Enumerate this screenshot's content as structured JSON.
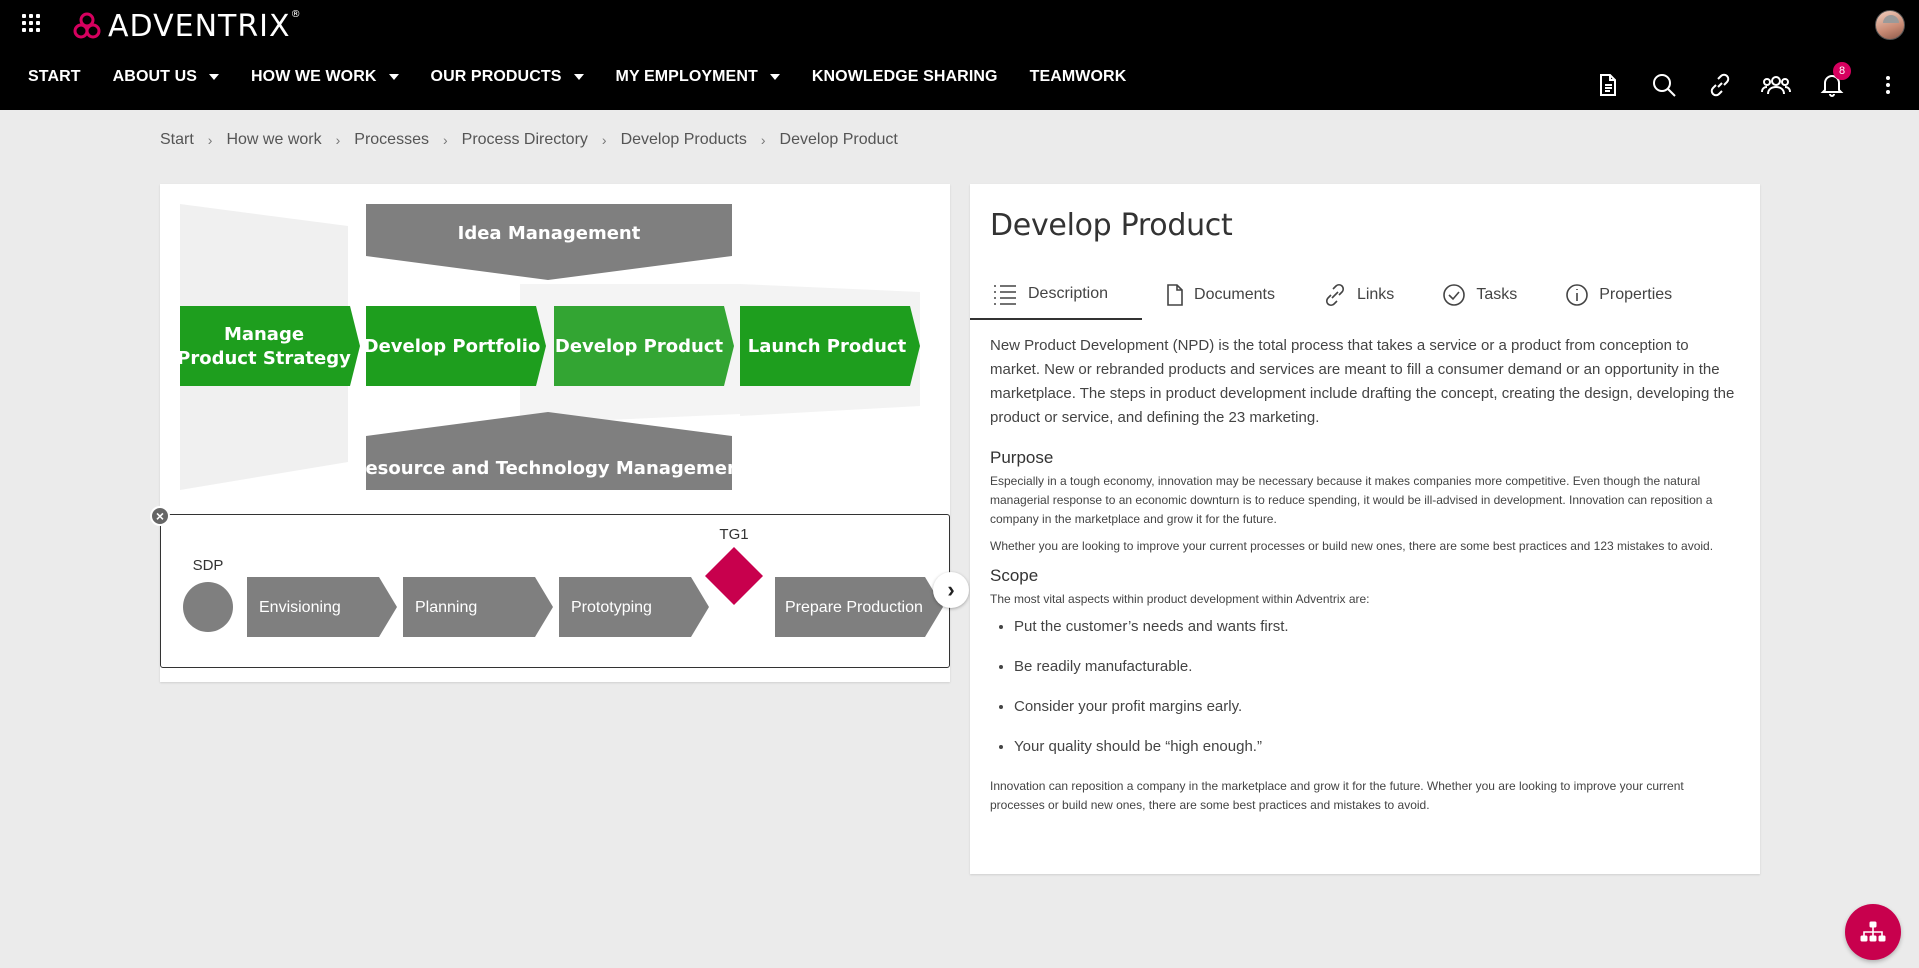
{
  "brand": {
    "name": "ADVENTRIX",
    "registered": "®",
    "accent": "#d6005f"
  },
  "nav": [
    {
      "label": "START",
      "dropdown": false
    },
    {
      "label": "ABOUT US",
      "dropdown": true
    },
    {
      "label": "HOW WE WORK",
      "dropdown": true
    },
    {
      "label": "OUR PRODUCTS",
      "dropdown": true
    },
    {
      "label": "MY EMPLOYMENT",
      "dropdown": true
    },
    {
      "label": "KNOWLEDGE SHARING",
      "dropdown": false
    },
    {
      "label": "TEAMWORK",
      "dropdown": false
    }
  ],
  "toolbar": {
    "icons": [
      "document-icon",
      "search-icon",
      "link-icon",
      "team-icon",
      "bell-icon",
      "more-icon"
    ],
    "notification_count": "8"
  },
  "breadcrumb": [
    "Start",
    "How we work",
    "Processes",
    "Process Directory",
    "Develop Products",
    "Develop Product"
  ],
  "process_map": {
    "top": "Idea Management",
    "bottom": "Resource and Technology Management",
    "chain": [
      {
        "line1": "Manage",
        "line2": "Product Strategy"
      },
      {
        "line1": "Develop Portfolio",
        "line2": ""
      },
      {
        "line1": "Develop Product",
        "line2": "",
        "active": true
      },
      {
        "line1": "Launch Product",
        "line2": ""
      }
    ],
    "colors": {
      "green": "#1e9e1e",
      "green_active": "#33a533",
      "gray": "#7f7f7f"
    }
  },
  "phases": {
    "start_label": "SDP",
    "gate_label": "TG1",
    "steps": [
      "Envisioning",
      "Planning",
      "Prototyping",
      "Prepare Production"
    ],
    "gate_color": "#c8004d"
  },
  "detail": {
    "title": "Develop Product",
    "tabs": [
      {
        "label": "Description",
        "icon": "list-icon",
        "active": true
      },
      {
        "label": "Documents",
        "icon": "file-icon"
      },
      {
        "label": "Links",
        "icon": "link-icon"
      },
      {
        "label": "Tasks",
        "icon": "check-circle-icon"
      },
      {
        "label": "Properties",
        "icon": "info-icon"
      }
    ],
    "intro": "New Product Development (NPD) is the total process that takes a service or a product from conception to market. New or rebranded products and services are meant to fill a consumer demand or an opportunity in the marketplace. The steps in product development include drafting the concept, creating the design, developing the product or service, and defining the 23 marketing.",
    "purpose_heading": "Purpose",
    "purpose_p1": "Especially in a tough economy, innovation may be necessary because it makes companies more competitive. Even though the natural managerial response to an economic downturn is to reduce spending, it would be ill-advised in development. Innovation can reposition a company in the marketplace and grow it for the future.",
    "purpose_p2": "Whether you are looking to improve your current processes or build new ones, there are some best practices and 123 mistakes to avoid.",
    "scope_heading": "Scope",
    "scope_intro": "The most vital aspects within product development within Adventrix are:",
    "scope_items": [
      "Put the customer’s needs and wants first.",
      "Be readily manufacturable.",
      "Consider your profit margins early.",
      "Your quality should be “high enough.”"
    ],
    "closing": "Innovation can reposition a company in the marketplace and grow it for the future. Whether you are looking to improve your current processes or build new ones, there are some best practices and mistakes to avoid."
  },
  "fab": {
    "icon": "org-chart-icon",
    "color": "#c8004d"
  }
}
